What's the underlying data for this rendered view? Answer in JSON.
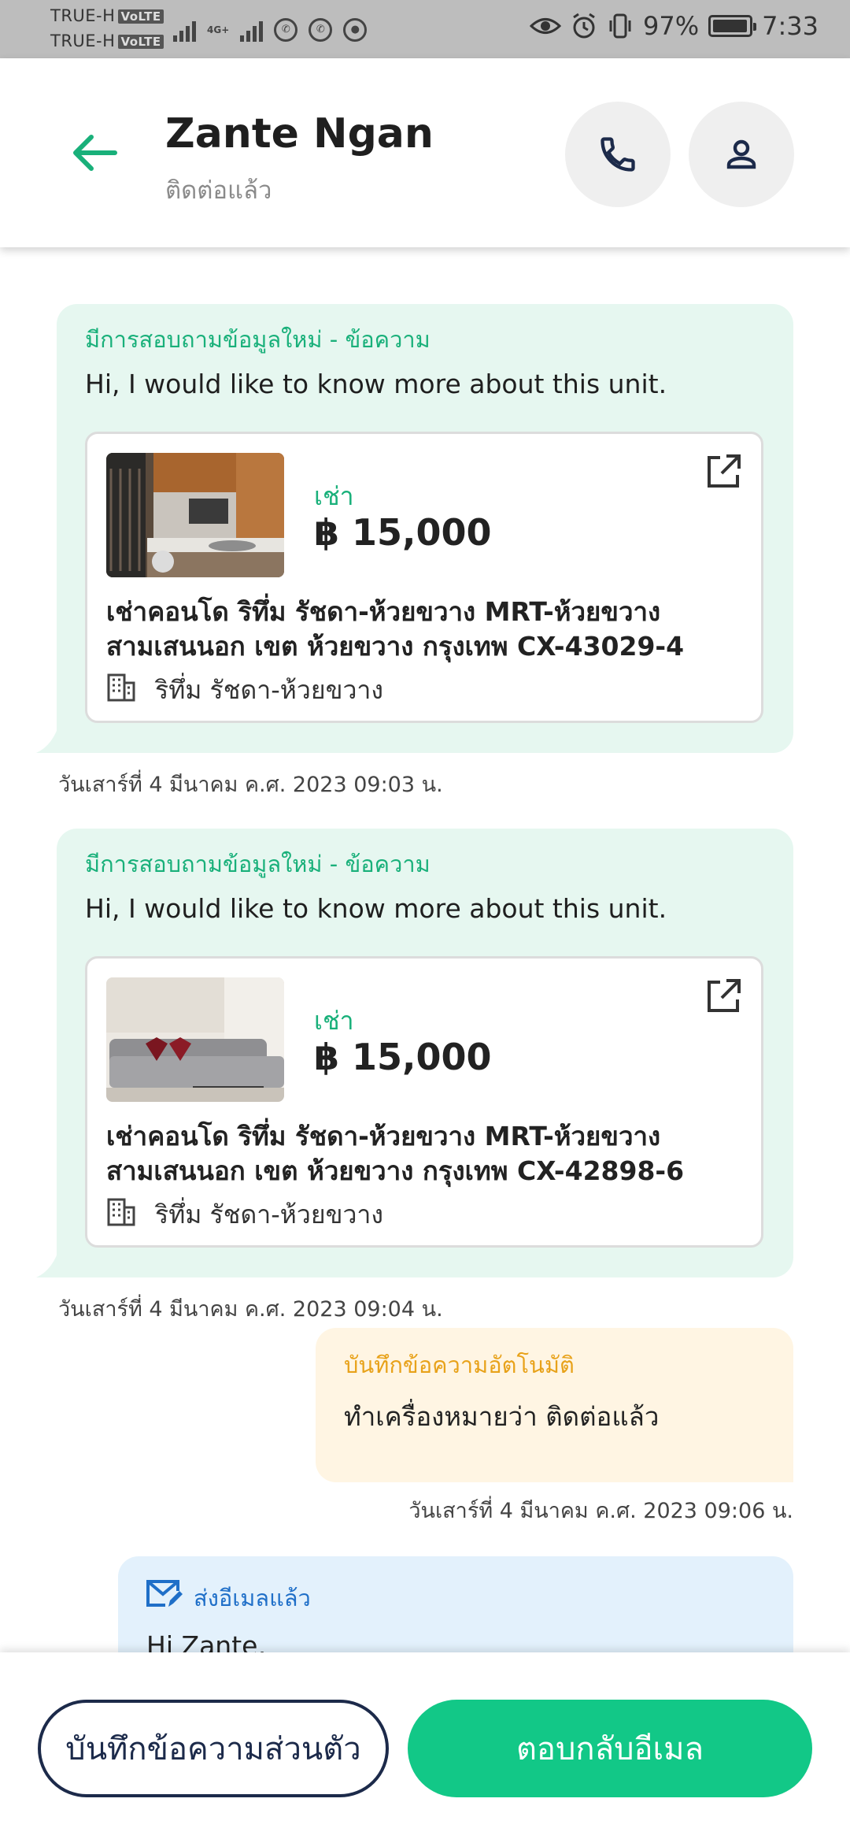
{
  "status_bar": {
    "carrier_1": "TRUE-H",
    "carrier_2": "TRUE-H",
    "volte": "VoLTE",
    "network_small": "4G+",
    "battery_percent": "97%",
    "time": "7:33",
    "battery_level": 0.97
  },
  "header": {
    "title": "Zante Ngan",
    "subtitle": "ติดต่อแล้ว"
  },
  "messages": [
    {
      "label": "มีการสอบถามข้อมูลใหม่ - ข้อความ",
      "text": "Hi, I would like to know more about this unit.",
      "listing": {
        "type": "เช่า",
        "price": "฿ 15,000",
        "title_line1": "เช่าคอนโด  ริทึ่ม รัชดา-ห้วยขวาง MRT-ห้วยขวาง",
        "title_line2": "สามเสนนอก เขต ห้วยขวาง กรุงเทพ CX-43029-4",
        "building": "ริทึ่ม รัชดา-ห้วยขวาง"
      },
      "timestamp": "วันเสาร์ที่ 4 มีนาคม ค.ศ. 2023 09:03 น."
    },
    {
      "label": "มีการสอบถามข้อมูลใหม่ - ข้อความ",
      "text": "Hi, I would like to know more about this unit.",
      "listing": {
        "type": "เช่า",
        "price": "฿ 15,000",
        "title_line1": "เช่าคอนโด  ริทึ่ม รัชดา-ห้วยขวาง MRT-ห้วยขวาง",
        "title_line2": "สามเสนนอก เขต ห้วยขวาง กรุงเทพ CX-42898-6",
        "building": "ริทึ่ม รัชดา-ห้วยขวาง"
      },
      "timestamp": "วันเสาร์ที่ 4 มีนาคม ค.ศ. 2023 09:04 น."
    }
  ],
  "auto_note": {
    "label": "บันทึกข้อความอัตโนมัติ",
    "text": "ทำเครื่องหมายว่า ติดต่อแล้ว",
    "timestamp": "วันเสาร์ที่ 4 มีนาคม ค.ศ. 2023 09:06 น."
  },
  "email": {
    "label": "ส่งอีเมลแล้ว",
    "text": "Hi Zante,"
  },
  "bottom": {
    "note_button": "บันทึกข้อความส่วนตัว",
    "reply_button": "ตอบกลับอีเมล"
  },
  "colors": {
    "accent_green": "#12c887",
    "label_green": "#19b07a",
    "incoming_bubble": "#e6f7f0",
    "note_bubble": "#fff5e3",
    "note_label": "#e8a21a",
    "email_bubble": "#e3f1fc",
    "email_label": "#1f6fc8",
    "navy": "#1c2a4a"
  },
  "icons": [
    "back-arrow-icon",
    "phone-icon",
    "person-icon",
    "external-link-icon",
    "building-icon",
    "mail-edit-icon"
  ]
}
